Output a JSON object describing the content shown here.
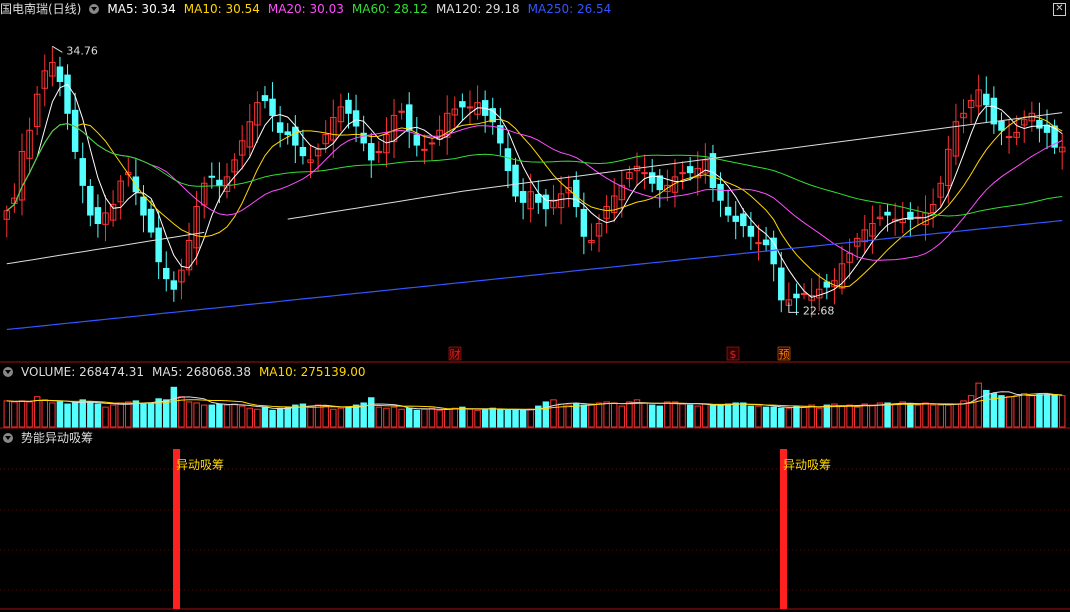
{
  "header": {
    "title": "国电南瑞(日线)",
    "ma": [
      {
        "label": "MA5: 30.34",
        "color": "#ffffff"
      },
      {
        "label": "MA10: 30.54",
        "color": "#ffd700"
      },
      {
        "label": "MA20: 30.03",
        "color": "#ff4dff"
      },
      {
        "label": "MA60: 28.12",
        "color": "#33dd33"
      },
      {
        "label": "MA120: 29.18",
        "color": "#dddddd"
      },
      {
        "label": "MA250: 26.54",
        "color": "#3355ff"
      }
    ]
  },
  "volume_header": {
    "label": "VOLUME: 268474.31",
    "ma5": "MA5: 268068.38",
    "ma10": "MA10: 275139.00",
    "ma5_color": "#dddddd",
    "ma10_color": "#ffd700"
  },
  "indicator_header": {
    "label": "势能异动吸筹"
  },
  "markers": {
    "cai": "财",
    "s": "$",
    "yu": "预"
  },
  "colors": {
    "up": "#ff3232",
    "down": "#54ffff",
    "signal": "#ff2020",
    "signal_text": "#ffd700"
  },
  "chart_data": {
    "type": "candlestick",
    "title": "国电南瑞(日线)",
    "annotations": [
      {
        "text": "34.76",
        "kind": "high"
      },
      {
        "text": "22.68",
        "kind": "low"
      }
    ],
    "signals": [
      {
        "bar": 25,
        "label": "异动吸筹"
      },
      {
        "bar": 112,
        "label": "异动吸筹"
      }
    ],
    "closes": [
      27.0,
      27.6,
      29.8,
      30.8,
      32.5,
      33.6,
      34.0,
      33.1,
      31.6,
      29.8,
      28.2,
      26.8,
      26.4,
      26.9,
      27.3,
      28.4,
      28.8,
      27.9,
      26.8,
      26.0,
      24.6,
      23.8,
      23.3,
      24.2,
      25.6,
      27.2,
      28.3,
      28.6,
      28.2,
      28.6,
      29.4,
      30.3,
      31.2,
      32.1,
      32.2,
      31.5,
      30.7,
      30.6,
      30.1,
      29.6,
      29.4,
      29.9,
      30.6,
      31.4,
      31.9,
      31.6,
      31.0,
      30.2,
      29.4,
      29.8,
      30.6,
      31.5,
      31.7,
      30.8,
      30.1,
      29.9,
      30.2,
      30.8,
      31.6,
      31.8,
      31.9,
      31.9,
      32.1,
      31.5,
      31.2,
      30.2,
      28.9,
      27.7,
      27.4,
      27.9,
      27.4,
      27.1,
      27.5,
      27.8,
      28.1,
      27.2,
      25.8,
      25.6,
      26.4,
      27.2,
      27.7,
      28.2,
      28.8,
      29.1,
      28.8,
      28.3,
      28.0,
      28.2,
      28.6,
      28.8,
      28.8,
      29.0,
      29.4,
      28.1,
      27.5,
      26.8,
      26.5,
      26.3,
      25.8,
      25.5,
      25.4,
      24.5,
      22.8,
      22.8,
      22.9,
      23.1,
      23.0,
      23.3,
      23.4,
      23.7,
      24.5,
      25.0,
      25.7,
      26.1,
      26.4,
      26.7,
      26.8,
      26.6,
      26.6,
      26.6,
      26.7,
      26.9,
      27.3,
      28.3,
      29.9,
      31.2,
      31.6,
      32.2,
      32.7,
      32.0,
      31.1,
      30.8,
      30.5,
      30.7,
      31.3,
      31.6,
      30.9,
      30.7,
      30.0,
      30.0
    ],
    "volumes": [
      0.25,
      0.24,
      0.25,
      0.24,
      0.29,
      0.26,
      0.23,
      0.24,
      0.22,
      0.23,
      0.26,
      0.24,
      0.22,
      0.19,
      0.21,
      0.23,
      0.24,
      0.25,
      0.22,
      0.23,
      0.27,
      0.26,
      0.38,
      0.29,
      0.24,
      0.23,
      0.21,
      0.21,
      0.22,
      0.21,
      0.22,
      0.2,
      0.18,
      0.17,
      0.19,
      0.16,
      0.18,
      0.19,
      0.21,
      0.22,
      0.2,
      0.21,
      0.2,
      0.17,
      0.18,
      0.19,
      0.21,
      0.23,
      0.28,
      0.19,
      0.18,
      0.19,
      0.17,
      0.18,
      0.16,
      0.17,
      0.18,
      0.16,
      0.17,
      0.18,
      0.19,
      0.17,
      0.16,
      0.17,
      0.18,
      0.17,
      0.16,
      0.16,
      0.16,
      0.17,
      0.2,
      0.24,
      0.26,
      0.22,
      0.21,
      0.22,
      0.21,
      0.22,
      0.23,
      0.24,
      0.23,
      0.2,
      0.24,
      0.26,
      0.23,
      0.21,
      0.2,
      0.24,
      0.24,
      0.22,
      0.21,
      0.2,
      0.22,
      0.21,
      0.21,
      0.22,
      0.23,
      0.23,
      0.2,
      0.2,
      0.19,
      0.19,
      0.18,
      0.18,
      0.2,
      0.19,
      0.21,
      0.18,
      0.21,
      0.22,
      0.2,
      0.21,
      0.19,
      0.22,
      0.21,
      0.23,
      0.23,
      0.22,
      0.24,
      0.22,
      0.21,
      0.23,
      0.21,
      0.21,
      0.21,
      0.22,
      0.25,
      0.3,
      0.42,
      0.35,
      0.32,
      0.3,
      0.29,
      0.3,
      0.32,
      0.3,
      0.31,
      0.31,
      0.31,
      0.3
    ]
  }
}
